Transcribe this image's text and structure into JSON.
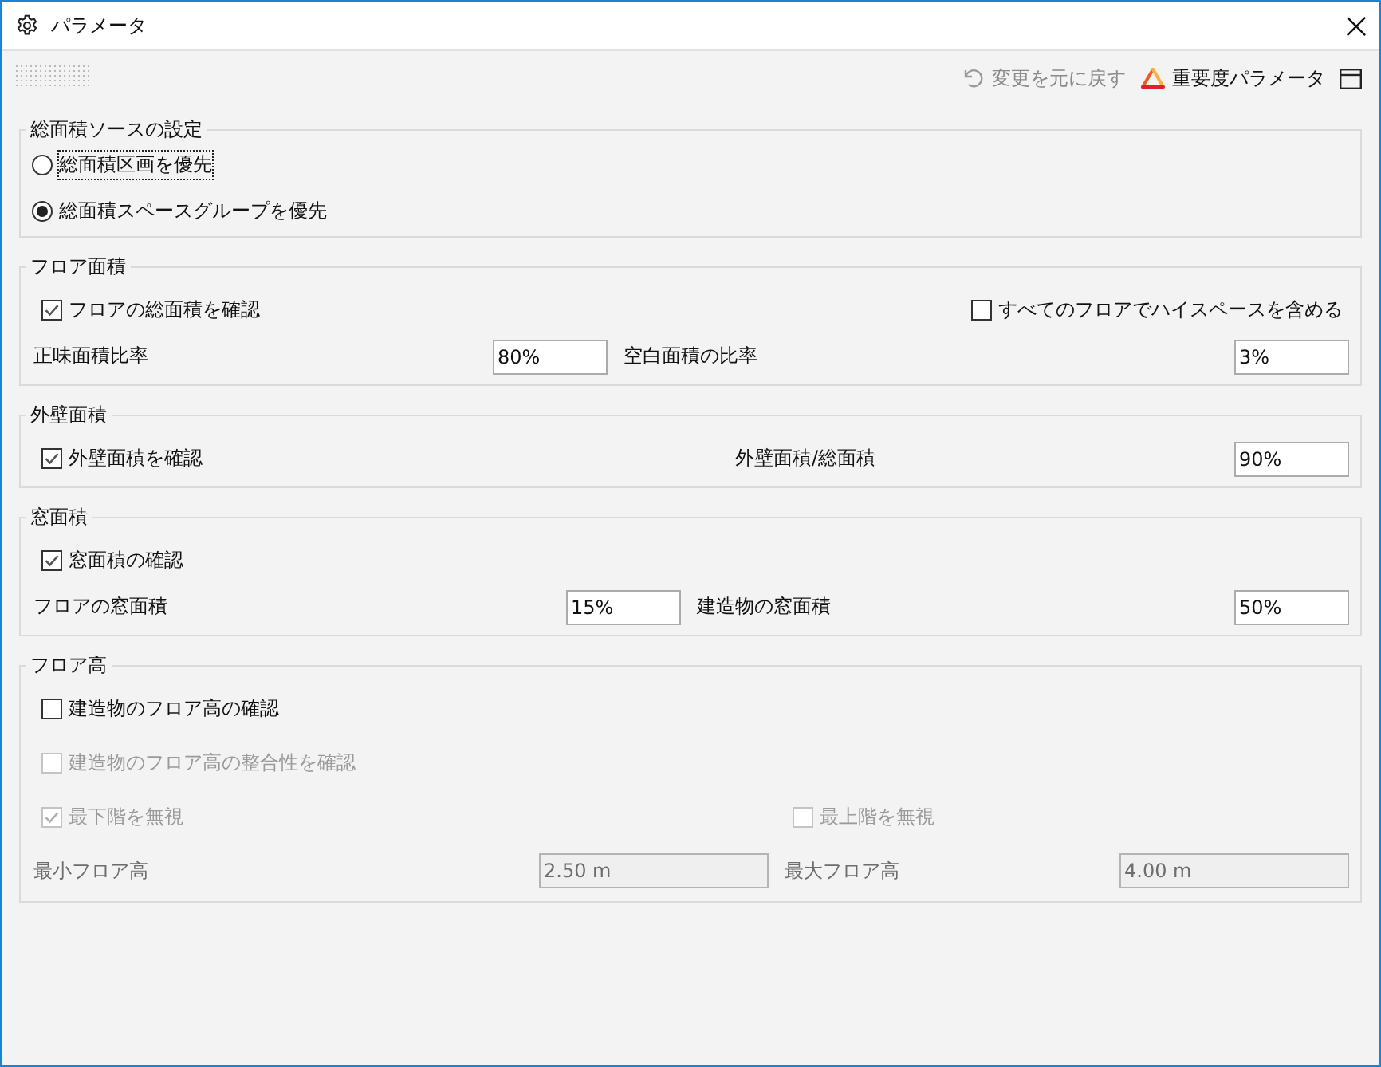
{
  "window": {
    "title": "パラメータ"
  },
  "toolbar": {
    "undo": {
      "label": "変更を元に戻す",
      "disabled": true
    },
    "importance": {
      "label": "重要度パラメータ"
    }
  },
  "groups": [
    {
      "title": "総面積ソースの設定",
      "rows": [
        {
          "items": [
            {
              "kind": "radio",
              "label": "総面積区画を優先",
              "selected": false,
              "focused": true
            }
          ]
        },
        {
          "items": [
            {
              "kind": "radio",
              "label": "総面積スペースグループを優先",
              "selected": true,
              "focused": false
            }
          ]
        }
      ]
    },
    {
      "title": "フロア面積",
      "rows": [
        {
          "items": [
            {
              "kind": "checkbox",
              "label": "フロアの総面積を確認",
              "checked": true,
              "disabled": false
            },
            {
              "kind": "checkbox",
              "label": "すべてのフロアでハイスペースを含める",
              "checked": false,
              "disabled": false
            }
          ]
        },
        {
          "items": [
            {
              "kind": "field",
              "label": "正味面積比率",
              "value": "80%",
              "disabled": false
            },
            {
              "kind": "field",
              "label": "空白面積の比率",
              "value": "3%",
              "disabled": false
            }
          ]
        }
      ]
    },
    {
      "title": "外壁面積",
      "rows": [
        {
          "items": [
            {
              "kind": "checkbox",
              "label": "外壁面積を確認",
              "checked": true,
              "disabled": false
            },
            {
              "kind": "field",
              "label": "外壁面積/総面積",
              "value": "90%",
              "disabled": false
            }
          ]
        }
      ]
    },
    {
      "title": "窓面積",
      "rows": [
        {
          "items": [
            {
              "kind": "checkbox",
              "label": "窓面積の確認",
              "checked": true,
              "disabled": false
            }
          ]
        },
        {
          "items": [
            {
              "kind": "field",
              "label": "フロアの窓面積",
              "value": "15%",
              "disabled": false
            },
            {
              "kind": "field",
              "label": "建造物の窓面積",
              "value": "50%",
              "disabled": false
            }
          ]
        }
      ]
    },
    {
      "title": "フロア高",
      "rows": [
        {
          "items": [
            {
              "kind": "checkbox",
              "label": "建造物のフロア高の確認",
              "checked": false,
              "disabled": false
            }
          ]
        },
        {
          "items": [
            {
              "kind": "checkbox",
              "label": "建造物のフロア高の整合性を確認",
              "checked": false,
              "disabled": true
            }
          ]
        },
        {
          "items": [
            {
              "kind": "checkbox",
              "label": "最下階を無視",
              "checked": true,
              "disabled": true
            },
            {
              "kind": "checkbox",
              "label": "最上階を無視",
              "checked": false,
              "disabled": true
            }
          ]
        },
        {
          "items": [
            {
              "kind": "field",
              "label": "最小フロア高",
              "value": "2.50 m",
              "disabled": true
            },
            {
              "kind": "field",
              "label": "最大フロア高",
              "value": "4.00 m",
              "disabled": true
            }
          ]
        }
      ]
    }
  ]
}
